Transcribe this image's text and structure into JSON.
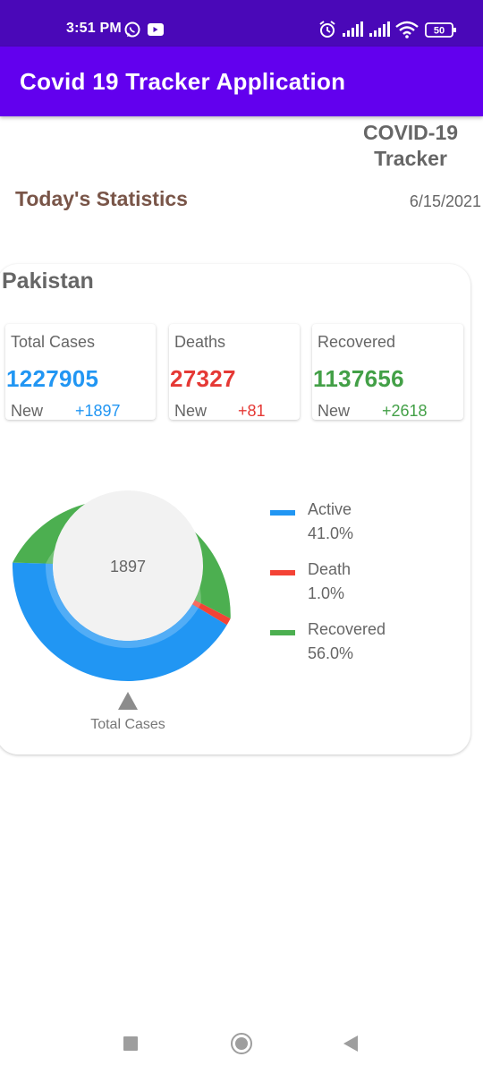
{
  "status_bar": {
    "time": "3:51 PM",
    "left_icons": [
      "whatsapp-icon",
      "youtube-icon"
    ],
    "right_icons": [
      "alarm-icon",
      "signal-icon",
      "signal-icon",
      "wifi-icon",
      "battery-icon"
    ],
    "battery": "50",
    "color": "#4a08b8"
  },
  "app_bar": {
    "title": "Covid 19 Tracker Application",
    "color": "#6200ee"
  },
  "header": {
    "brand_line1": "COVID-19",
    "brand_line2": "Tracker",
    "section_title": "Today's Statistics",
    "date": "6/15/2021"
  },
  "country": {
    "name": "Pakistan",
    "stats": [
      {
        "label": "Total Cases",
        "value": "1227905",
        "new_label": "New",
        "new_value": "+1897",
        "color": "#2196f3"
      },
      {
        "label": "Deaths",
        "value": "27327",
        "new_label": "New",
        "new_value": "+81",
        "color": "#e53935"
      },
      {
        "label": "Recovered",
        "value": "1137656",
        "new_label": "New",
        "new_value": "+2618",
        "color": "#43a047"
      }
    ]
  },
  "chart_data": {
    "type": "pie",
    "center_label": "1897",
    "caption": "Total Cases",
    "series": [
      {
        "name": "Active",
        "value": 41.0,
        "label": "41.0%",
        "color": "#2196f3"
      },
      {
        "name": "Death",
        "value": 1.0,
        "label": "1.0%",
        "color": "#f44336"
      },
      {
        "name": "Recovered",
        "value": 56.0,
        "label": "56.0%",
        "color": "#4caf50"
      }
    ]
  },
  "nav_bar": {
    "buttons": [
      "recent-apps-icon",
      "home-icon",
      "back-icon"
    ]
  }
}
